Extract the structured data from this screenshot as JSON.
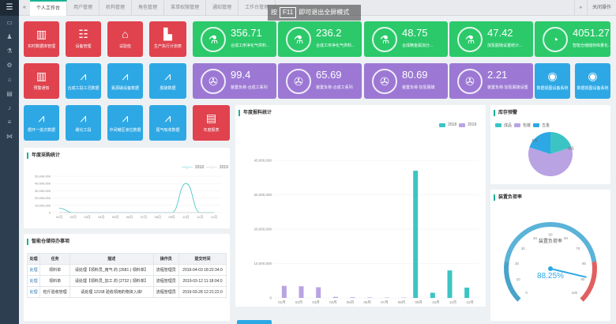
{
  "sidebar": {
    "icons": [
      "menu-icon",
      "monitor-icon",
      "user-icon",
      "flask-icon",
      "gear-icon",
      "home-icon",
      "chart-icon",
      "bell-icon",
      "list-icon",
      "share-icon"
    ]
  },
  "topbar": {
    "tabs": [
      "个人工作台",
      "用户管理",
      "机构管理",
      "角色管理",
      "菜单权限管理",
      "通知管理",
      "工作台管理"
    ],
    "right": [
      "关闭操作"
    ],
    "overlay_prefix": "按",
    "overlay_key": "F11",
    "overlay_suffix": "即可退出全屏模式"
  },
  "tiles_red": [
    "实时数据库管理",
    "设备管理",
    "试验检",
    "生产执行计划表",
    "预警通知"
  ],
  "tiles_blue": [
    "合成工段工况数据",
    "氯源碱设备数据",
    "脱硫数据",
    "循环一批次数据",
    "缓化工段",
    "中间罐区液位数据",
    "尾气吸收数据"
  ],
  "tile_report": "年度报表",
  "stats": [
    {
      "value": "356.71",
      "label": "合成工序净化气供料..."
    },
    {
      "value": "236.2",
      "label": "合成工序净化气供料..."
    },
    {
      "value": "48.75",
      "label": "合成精金属加分..."
    },
    {
      "value": "47.42",
      "label": "加氢脱硫设置统计..."
    },
    {
      "value": "4051.27",
      "label": "智能仓储储存库量化..."
    },
    {
      "value": "99.4",
      "label": "装置负荷·合成工系列"
    },
    {
      "value": "65.69",
      "label": "装置负荷·合成工系列"
    },
    {
      "value": "80.69",
      "label": "装置负荷·加氢脱硫"
    },
    {
      "value": "2.21",
      "label": "装置负荷·加氢脱硫设置"
    }
  ],
  "eye_tiles": [
    "数据视图设备系统",
    "数据视图设备系统"
  ],
  "purchase": {
    "title": "年度采购统计",
    "legend": [
      "2018",
      "2019"
    ],
    "yticks": [
      "50,000,000",
      "40,000,000",
      "30,000,000",
      "20,000,000",
      "10,000,000",
      "0"
    ],
    "months": [
      "01月",
      "02月",
      "03月",
      "04月",
      "05月",
      "06月",
      "07月",
      "08月",
      "09月",
      "10月",
      "11月",
      "12月"
    ]
  },
  "todo": {
    "title": "智能仓储待办事项",
    "headers": [
      "处理",
      "任务",
      "描述",
      "操作员",
      "提交时间"
    ],
    "rows": [
      [
        "处理",
        "领料单",
        "请处理【领料员_南气 的 (2681 ) 领料单】",
        "流程管理员",
        "2019-04-03 18:22:34.0"
      ],
      [
        "处理",
        "领料单",
        "请处理【领料员_加工 的 (2732 ) 领料单】",
        "流程管理员",
        "2019-03-12 11:18:04.0"
      ],
      [
        "处理",
        "检斤验收管理",
        "请处理 12168 验收领用的物资入库!",
        "流程管理员",
        "2019-03-28 12:21:22.0"
      ]
    ]
  },
  "storage": {
    "title": "年度报料统计",
    "legend": [
      "2018",
      "2019"
    ],
    "yticks": [
      "40,000,000",
      "30,000,000",
      "20,000,000",
      "10,000,000",
      "0"
    ],
    "months": [
      "01月",
      "02月",
      "03月",
      "04月",
      "05月",
      "06月",
      "07月",
      "08月",
      "09月",
      "10月",
      "11月",
      "12月"
    ]
  },
  "stock": {
    "title": "库存预警",
    "legend": [
      "成品",
      "包装",
      "五金"
    ],
    "slice_labels": [
      "五金",
      "成品"
    ]
  },
  "load": {
    "title": "装置负荷率",
    "gauge_label": "装置负荷率",
    "gauge_value": "88.25%",
    "ticks": [
      "0",
      "10",
      "20",
      "30",
      "40",
      "50",
      "60",
      "70",
      "80",
      "90",
      "100"
    ]
  },
  "chart_data": [
    {
      "type": "line",
      "title": "年度采购统计",
      "categories": [
        "01月",
        "02月",
        "03月",
        "04月",
        "05月",
        "06月",
        "07月",
        "08月",
        "09月",
        "10月",
        "11月",
        "12月"
      ],
      "series": [
        {
          "name": "2018",
          "values": [
            6000000,
            0,
            0,
            0,
            0,
            0,
            0,
            0,
            0,
            40000000,
            0,
            0
          ]
        },
        {
          "name": "2019",
          "values": [
            0,
            0,
            0,
            0,
            0,
            0,
            0,
            0,
            0,
            0,
            0,
            0
          ]
        }
      ],
      "ylim": [
        0,
        50000000
      ]
    },
    {
      "type": "bar",
      "title": "年度报料统计",
      "categories": [
        "01月",
        "02月",
        "03月",
        "04月",
        "05月",
        "06月",
        "07月",
        "08月",
        "09月",
        "10月",
        "11月",
        "12月"
      ],
      "series": [
        {
          "name": "2018",
          "values": [
            0,
            0,
            0,
            0,
            0,
            0,
            0,
            0,
            37000000,
            1500000,
            8000000,
            3000000
          ]
        },
        {
          "name": "2019",
          "values": [
            3500000,
            3400000,
            3100000,
            300000,
            200000,
            150000,
            100000,
            100000,
            0,
            0,
            0,
            0
          ]
        }
      ],
      "ylim": [
        0,
        40000000
      ]
    },
    {
      "type": "pie",
      "title": "库存预警",
      "categories": [
        "成品",
        "包装",
        "五金"
      ],
      "values": [
        20,
        60,
        20
      ]
    }
  ],
  "colors": {
    "red": "#e0424e",
    "blue": "#2ea8e5",
    "green": "#2bc96a",
    "purple": "#9c78d4",
    "teal": "#3cc4c4",
    "lavender": "#b9a3e3"
  }
}
